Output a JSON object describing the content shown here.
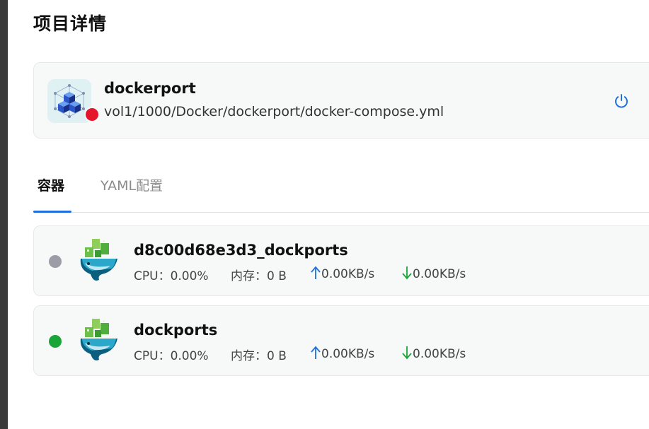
{
  "page": {
    "title": "项目详情"
  },
  "project": {
    "name": "dockerport",
    "path": "vol1/1000/Docker/dockerport/docker-compose.yml",
    "status_color": "#e5152b",
    "icon": "cubes-icon",
    "action_icon": "power-icon"
  },
  "tabs": [
    {
      "label": "容器",
      "active": true
    },
    {
      "label": "YAML配置",
      "active": false
    }
  ],
  "accent_color": "#1f6fe0",
  "containers": [
    {
      "name": "d8c00d68e3d3_dockports",
      "status_color": "#9a9ca6",
      "icon": "docker-whale-icon",
      "cpu_label": "CPU：",
      "cpu": "0.00%",
      "mem_label": "内存：",
      "mem": "0 B",
      "upload": "0.00KB/s",
      "download": "0.00KB/s"
    },
    {
      "name": "dockports",
      "status_color": "#1aa538",
      "icon": "docker-whale-icon",
      "cpu_label": "CPU：",
      "cpu": "0.00%",
      "mem_label": "内存：",
      "mem": "0 B",
      "upload": "0.00KB/s",
      "download": "0.00KB/s"
    }
  ]
}
